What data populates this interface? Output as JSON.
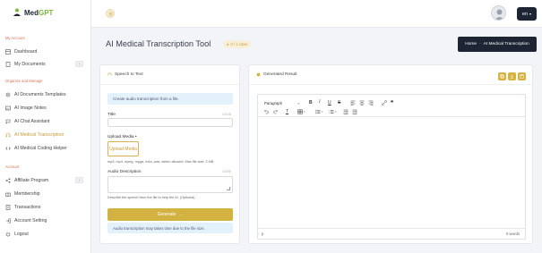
{
  "app": {
    "name_part1": "Med",
    "name_part2": "GPT"
  },
  "sidebar": {
    "sections": [
      {
        "title": "My Account"
      },
      {
        "title": "Organize and Manage"
      },
      {
        "title": "Account"
      }
    ],
    "items": [
      {
        "label": "Dashboard",
        "icon": "dashboard-icon"
      },
      {
        "label": "My Documents",
        "icon": "document-icon"
      },
      {
        "label": "AI Documents Templates",
        "icon": "gear-icon"
      },
      {
        "label": "AI Image Notes",
        "icon": "image-icon"
      },
      {
        "label": "AI Chat Assistant",
        "icon": "chat-icon"
      },
      {
        "label": "AI Medical Transcription",
        "icon": "headphones-icon"
      },
      {
        "label": "AI Medical Coding Helper",
        "icon": "code-icon"
      },
      {
        "label": "Affiliate Program",
        "icon": "share-icon"
      },
      {
        "label": "Membership",
        "icon": "gift-icon"
      },
      {
        "label": "Transactions",
        "icon": "receipt-icon"
      },
      {
        "label": "Account Setting",
        "icon": "login-icon"
      },
      {
        "label": "Logout",
        "icon": "power-icon"
      }
    ]
  },
  "topbar": {
    "lang": "en"
  },
  "page": {
    "title": "AI Medical Transcription Tool",
    "usage_badge": "0 / 1 Uses",
    "breadcrumb": {
      "home": "Home",
      "sep": "-",
      "current": "AI Medical Transcription"
    }
  },
  "form": {
    "header": "Speech to Text",
    "info": "Create audio transcription from a file.",
    "title_label": "Title",
    "title_count": "0/100",
    "upload_label": "Upload Media •",
    "upload_button": "Upload Media",
    "upload_help": "mp3, mp4, mpeg, mpga, m4a, wav, webm allowed. Max file size: 2 MB",
    "desc_label": "Audio Description",
    "desc_count": "0/200",
    "desc_help": "Describe the speech from the file to help the AI. (Optional)",
    "generate_button": "Generate",
    "generate_arrow": "→",
    "note": "Audio transcription may takes time due to the file size."
  },
  "result": {
    "header": "Generated Result",
    "paragraph_select": "Paragraph",
    "status_path": "p",
    "word_count": "0 words"
  },
  "colors": {
    "accent": "#d2b240",
    "dark": "#1d2433",
    "info_bg": "#e3f1fb",
    "section": "#d6735a"
  }
}
